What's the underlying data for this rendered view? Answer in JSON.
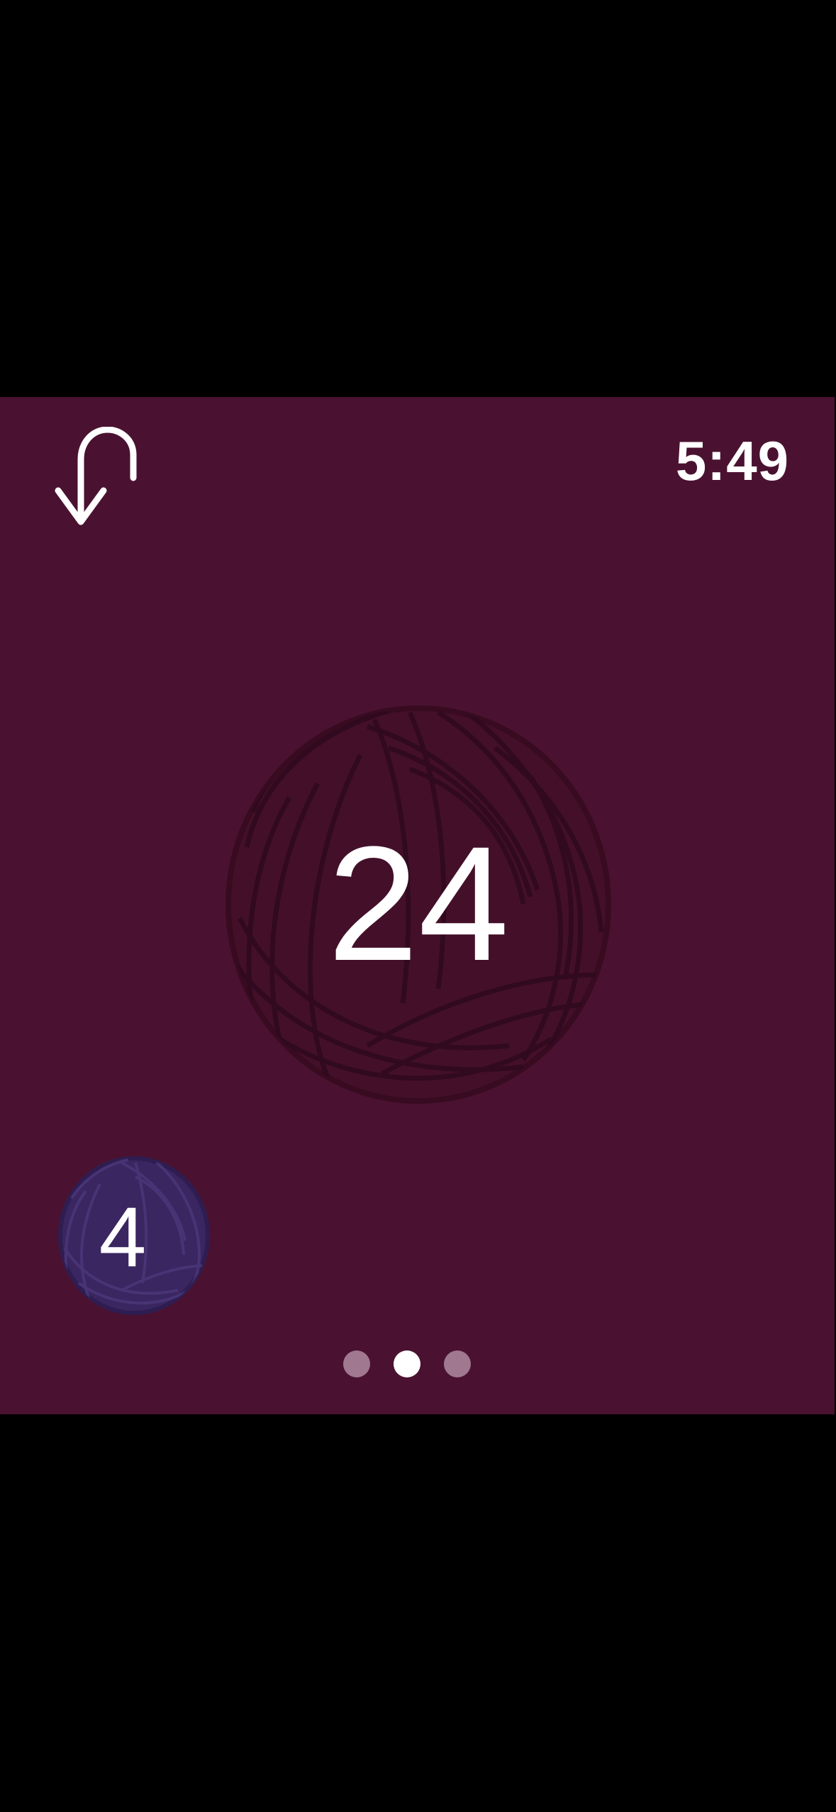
{
  "status": {
    "time": "5:49"
  },
  "toolbar": {
    "undo_icon": "undo-curved-arrow-icon"
  },
  "counters": {
    "main": {
      "value": "24",
      "icon": "yarn-ball-icon",
      "color": "#3f0e27"
    },
    "secondary": {
      "value": "4",
      "icon": "yarn-ball-icon",
      "color": "#3a2660"
    }
  },
  "pager": {
    "count": 3,
    "active_index": 1,
    "active_color": "#ffffff",
    "inactive_color": "#a0788f"
  },
  "theme": {
    "background": "#4a1230",
    "outer": "#000000",
    "text": "#ffffff"
  }
}
